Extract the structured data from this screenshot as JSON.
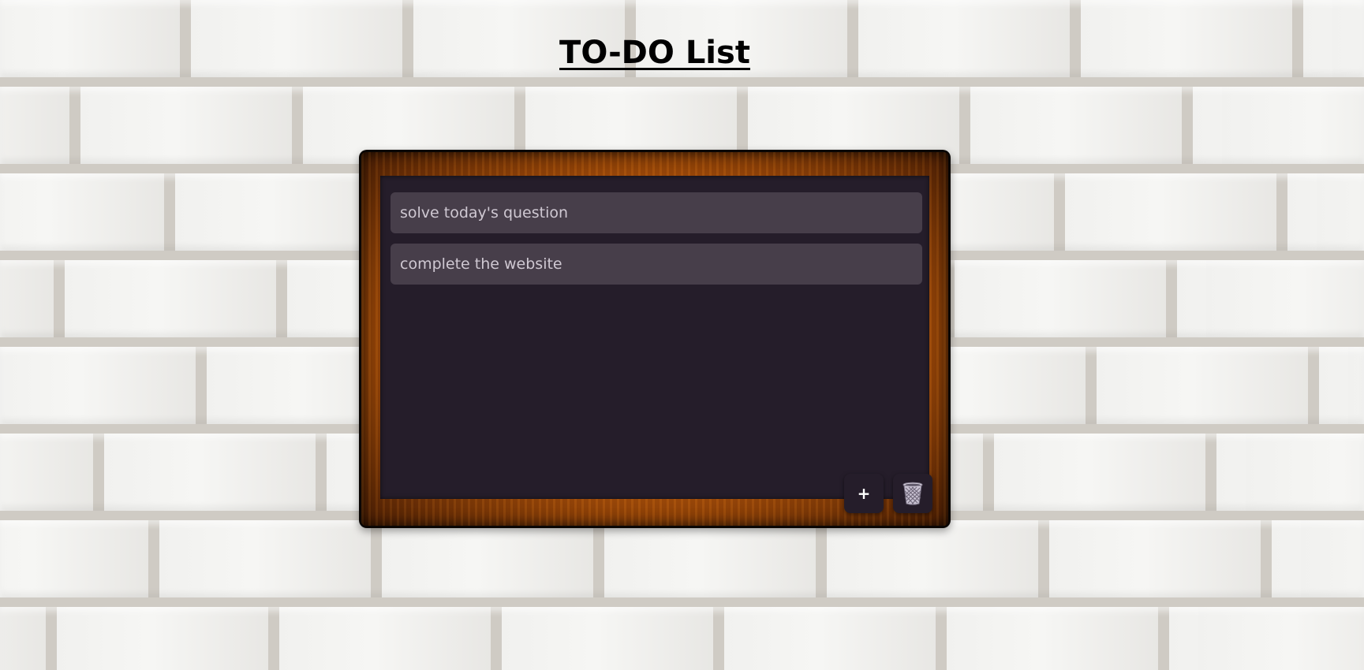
{
  "page": {
    "title": "TO-DO List"
  },
  "notes": [
    {
      "text": "solve today's question"
    },
    {
      "text": "complete the website"
    }
  ],
  "controls": {
    "add_label": "+",
    "delete_icon": "trash-can-icon"
  },
  "colors": {
    "slate": "#251d2a",
    "note_background": "#473e4a",
    "note_text": "#cfc8d2",
    "frame_wood": "#b8570c",
    "title_text": "#000000"
  }
}
